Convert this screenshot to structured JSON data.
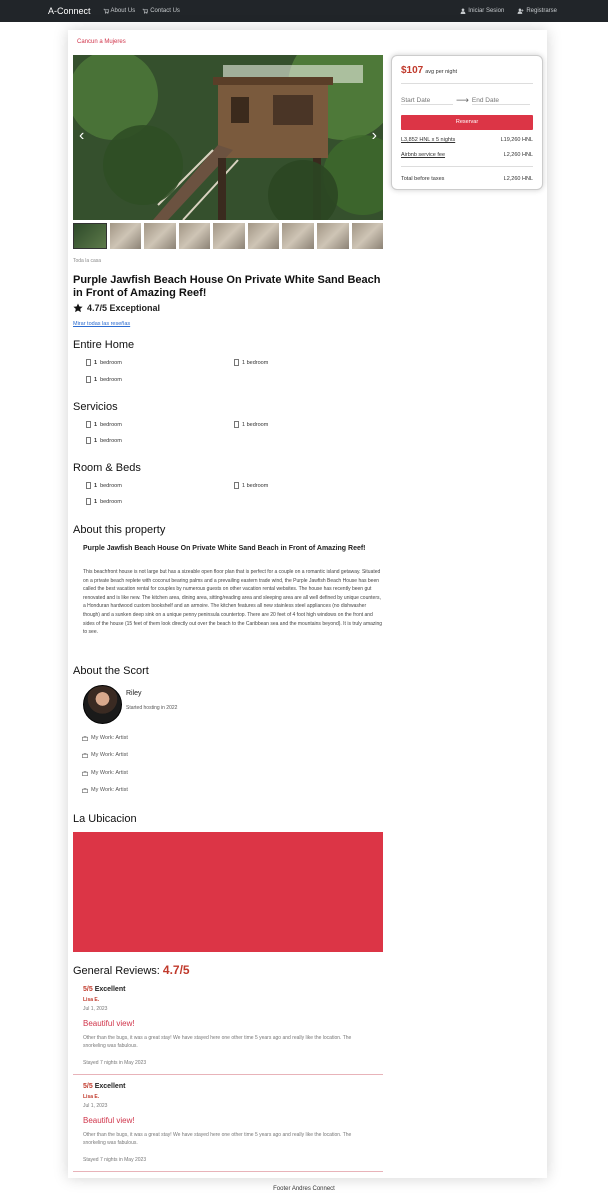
{
  "nav": {
    "brand": "A-Connect",
    "links": [
      "About Us",
      "Contact Us"
    ],
    "right": [
      "Iniciar Sesion",
      "Registrarse"
    ]
  },
  "listing": {
    "category_link": "Cancun a Mujeres",
    "all_label": "Toda la casa",
    "title": "Purple Jawfish Beach House On Private White Sand Beach in Front of Amazing Reef!",
    "rating": "4.7/5 Exceptional",
    "see_reviews": "Mirar todas las reseñas"
  },
  "sections": {
    "entire_home": {
      "title": "Entire Home",
      "items": [
        {
          "bold": "1",
          "text": "bedroom"
        },
        {
          "bold": "",
          "text": "1 bedroom"
        },
        {
          "bold": "1",
          "text": "bedroom"
        }
      ]
    },
    "servicios": {
      "title": "Servicios",
      "items": [
        {
          "bold": "1",
          "text": "bedroom"
        },
        {
          "bold": "",
          "text": "1 bedroom"
        },
        {
          "bold": "1",
          "text": "bedroom"
        }
      ]
    },
    "room_beds": {
      "title": "Room & Beds",
      "items": [
        {
          "bold": "1",
          "text": "bedroom"
        },
        {
          "bold": "",
          "text": "1 bedroom"
        },
        {
          "bold": "1",
          "text": "bedroom"
        }
      ]
    }
  },
  "about": {
    "title": "About this property",
    "subtitle": "Purple Jawfish Beach House On Private White Sand Beach in Front of Amazing Reef!",
    "body": "This beachfront house is not large but has a sizeable open floor plan that is perfect for a couple on a romantic island getaway. Situated on a private beach replete with coconut bearing palms and a prevailing eastern trade wind, the Purple Jawfish Beach House has been called the best vacation rental for couples by numerous guests on other vacation rental websites. The house has recently been gut renovated and is like new. The kitchen area, dining area, sitting/reading area and sleeping area are all well defined by unique counters, a Honduran hardwood custom bookshelf and an armoire. The kitchen features all new stainless steel appliances (no dishwasher though) and a sunken deep sink on a unique penny peninsula countertop. There are 20 feet of 4 foot high windows on the front and sides of the house (15 feet of them look directly out over the beach to the Caribbean sea and the mountains beyond). It is truly amazing to see."
  },
  "host": {
    "section_title": "About the Scort",
    "name": "Riley",
    "since": "Started hosting in 2022",
    "works": [
      "My Work: Artist",
      "My Work: Artist",
      "My Work: Artist",
      "My Work: Artist"
    ]
  },
  "location": {
    "title": "La Ubicacion"
  },
  "reviews": {
    "title": "General Reviews:",
    "score": "4.7/5",
    "items": [
      {
        "score": "5/5",
        "label": "Excellent",
        "name": "Lisa E.",
        "date": "Jul 1, 2023",
        "title": "Beautiful view!",
        "body": "Other than the bugs, it was a great stay! We have stayed here one other time 5 years ago and really like the location. The snorkeling was fabulous.",
        "stay": "Stayed 7 nights in May 2023"
      },
      {
        "score": "5/5",
        "label": "Excellent",
        "name": "Lisa E.",
        "date": "Jul 1, 2023",
        "title": "Beautiful view!",
        "body": "Other than the bugs, it was a great stay! We have stayed here one other time 5 years ago and really like the location. The snorkeling was fabulous.",
        "stay": "Stayed 7 nights in May 2023"
      }
    ]
  },
  "booking": {
    "price": "$107",
    "per_night": "avg per night",
    "start_placeholder": "Start Date",
    "end_placeholder": "End Date",
    "reserve": "Reservar",
    "rows": [
      {
        "label": "L3,852 HNL x 5 nights",
        "value": "L19,260 HNL"
      },
      {
        "label": "Airbnb service fee",
        "value": "L2,260 HNL"
      }
    ],
    "total_label": "Total before taxes",
    "total_value": "L2,260 HNL"
  },
  "footer": "Footer Andres Connect",
  "colors": {
    "accent": "#dc3546",
    "navbar": "#212529"
  }
}
